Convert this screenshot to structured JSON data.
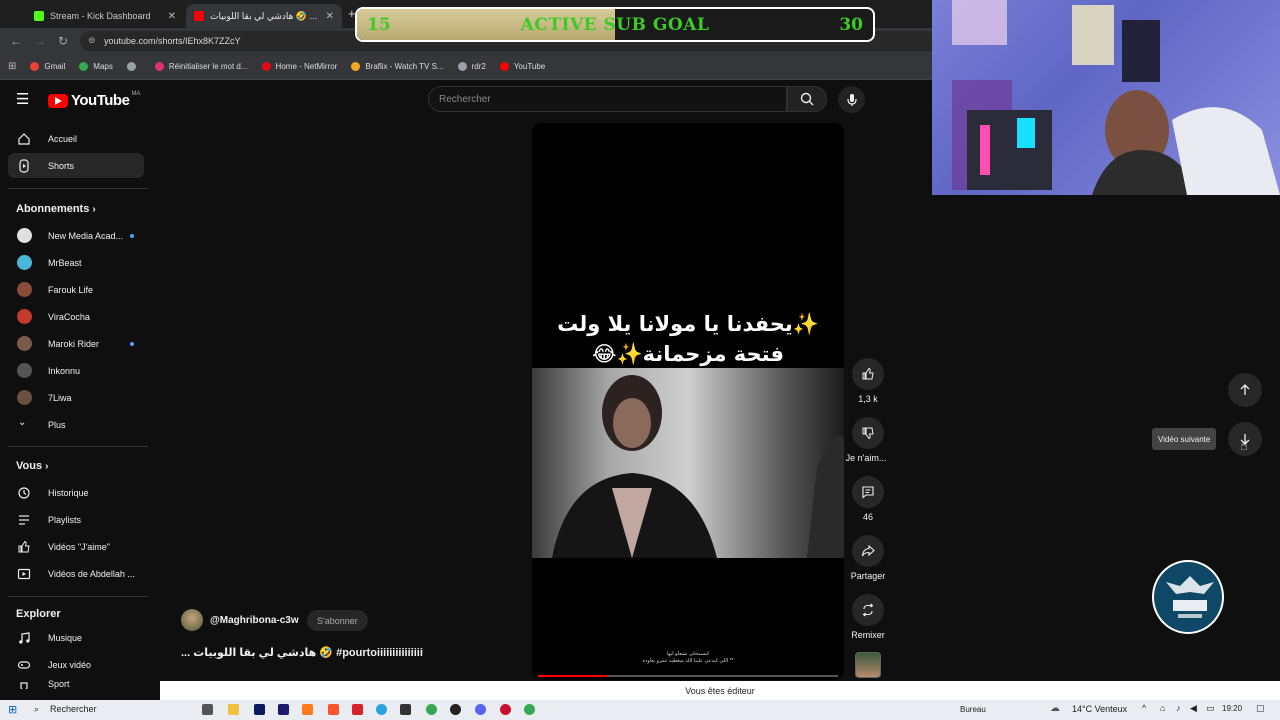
{
  "browser": {
    "tabs": [
      {
        "title": "Stream - Kick Dashboard",
        "color": "#53fc18"
      },
      {
        "title": "هادشي لي بقا اللوبيات 🤣 ...",
        "prefix": "(#)",
        "color": "#ff0000"
      }
    ],
    "new_tab": "+",
    "url": "youtube.com/shorts/IEhx8K7ZZcY",
    "bookmarks": [
      {
        "label": "Gmail",
        "color": "#ea4335"
      },
      {
        "label": "Maps",
        "color": "#34a853"
      },
      {
        "label": "",
        "color": "#9aa0a6"
      },
      {
        "label": "Réinitialiser le mot d...",
        "color": "#e1306c"
      },
      {
        "label": "Home - NetMirror",
        "color": "#e50914"
      },
      {
        "label": "Braflix - Watch TV S...",
        "color": "#f5a623"
      },
      {
        "label": "rdr2",
        "color": "#9aa0a6"
      },
      {
        "label": "YouTube",
        "color": "#ff0000"
      }
    ]
  },
  "sub_goal": {
    "current": "15",
    "target": "30",
    "title": "ACTIVE SUB GOAL",
    "progress_fraction": 0.5
  },
  "youtube": {
    "logo": "YouTube",
    "country": "MA",
    "search_placeholder": "Rechercher",
    "sidebar": {
      "main": [
        {
          "label": "Accueil",
          "icon": "home-icon"
        },
        {
          "label": "Shorts",
          "icon": "shorts-icon",
          "active": true
        }
      ],
      "subscriptions_title": "Abonnements",
      "subscriptions": [
        {
          "label": "New Media Acad...",
          "color": "#e0e0e0",
          "dot": true
        },
        {
          "label": "MrBeast",
          "color": "#49b6d6",
          "dot": false
        },
        {
          "label": "Farouk Life",
          "color": "#8a4b3a",
          "dot": false
        },
        {
          "label": "ViraCocha",
          "color": "#c23b2b",
          "dot": false
        },
        {
          "label": "Maroki Rider",
          "color": "#7a5a4a",
          "dot": true
        },
        {
          "label": "Inkonnu",
          "color": "#555555",
          "dot": false
        },
        {
          "label": "7Liwa",
          "color": "#6a5040",
          "dot": false
        },
        {
          "label": "Plus",
          "color": "",
          "dot": false
        }
      ],
      "you_title": "Vous",
      "you": [
        {
          "label": "Historique",
          "icon": "history-icon"
        },
        {
          "label": "Playlists",
          "icon": "playlist-icon"
        },
        {
          "label": "Vidéos \"J'aime\"",
          "icon": "like-icon"
        },
        {
          "label": "Vidéos de Abdellah ...",
          "icon": "video-icon"
        }
      ],
      "explore_title": "Explorer",
      "explore": [
        {
          "label": "Musique",
          "icon": "music-icon"
        },
        {
          "label": "Jeux vidéo",
          "icon": "game-icon"
        },
        {
          "label": "Sport",
          "icon": "trophy-icon"
        }
      ]
    },
    "short": {
      "caption_line1": "✨يحفدنا يا مولانا يلا ولت",
      "caption_line2": "فتحة مزحمانة✨😂",
      "small_subtitle_line1": "كيسمحلي نشعلو ليها",
      "small_subtitle_line2": "** اللي كيدعي علينا الله ميعطيه عمرو يعاوده",
      "progress_fraction": 0.23
    },
    "actions": {
      "likes": "1,3 k",
      "dislike": "Je n'aim...",
      "comments": "46",
      "share": "Partager",
      "remix": "Remixer"
    },
    "channel": {
      "handle": "@Maghribona-c3w",
      "subscribe": "S'abonner",
      "description": "... هادشي لي بقا اللوبيات 🤣 #pourtoiiiiiiiiiiiiiii"
    },
    "tooltip": "Vidéo suivante"
  },
  "status_bar": "Vous êtes éditeur",
  "taskbar": {
    "search": "Rechercher",
    "desktop": "Bureau",
    "weather": "14°C Venteux",
    "time": "19:20"
  }
}
